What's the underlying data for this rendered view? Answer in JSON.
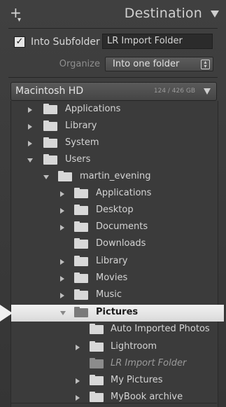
{
  "header": {
    "add_icon": "plus-icon",
    "title": "Destination",
    "collapse_icon": "triangle-down-icon"
  },
  "subfolder": {
    "checked": true,
    "label": "Into Subfolder",
    "value": "LR Import Folder"
  },
  "organize": {
    "label": "Organize",
    "selected": "Into one folder"
  },
  "volume": {
    "name": "Macintosh HD",
    "size": "124 / 426 GB"
  },
  "tree": [
    {
      "label": "Applications",
      "expand": "closed"
    },
    {
      "label": "Library",
      "expand": "closed"
    },
    {
      "label": "System",
      "expand": "closed"
    },
    {
      "label": "Users",
      "expand": "open"
    },
    {
      "label": "martin_evening",
      "expand": "open"
    },
    {
      "label": "Applications",
      "expand": "closed"
    },
    {
      "label": "Desktop",
      "expand": "closed"
    },
    {
      "label": "Documents",
      "expand": "closed"
    },
    {
      "label": "Downloads",
      "expand": "none"
    },
    {
      "label": "Library",
      "expand": "closed"
    },
    {
      "label": "Movies",
      "expand": "closed"
    },
    {
      "label": "Music",
      "expand": "closed"
    },
    {
      "label": "Pictures",
      "expand": "open",
      "selected": true
    },
    {
      "label": "Auto Imported Photos",
      "expand": "none"
    },
    {
      "label": "Lightroom",
      "expand": "closed"
    },
    {
      "label": "LR Import Folder",
      "expand": "none",
      "pending": true
    },
    {
      "label": "My Pictures",
      "expand": "closed"
    },
    {
      "label": "MyBook archive",
      "expand": "closed"
    }
  ]
}
